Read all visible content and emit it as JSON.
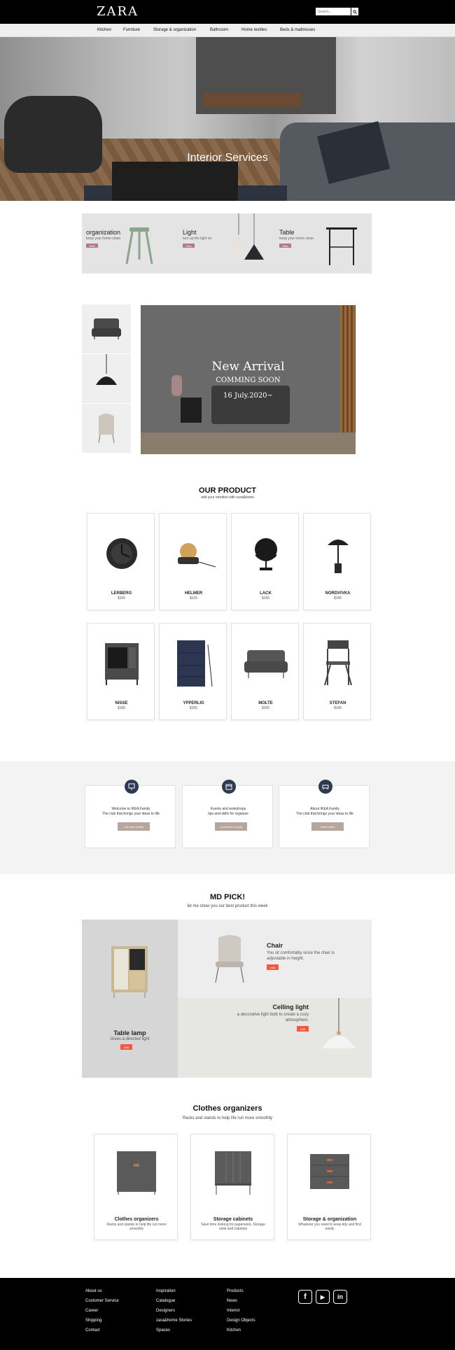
{
  "header": {
    "logo": "ZARA",
    "search_placeholder": "Search..."
  },
  "nav": [
    "Kitchen",
    "Furniture",
    "Storage & organization",
    "Bathroom",
    "Home textiles",
    "Beds & mattresses"
  ],
  "hero": {
    "title": "Interior Services"
  },
  "categories": [
    {
      "title": "organization",
      "desc": "keep your home clean",
      "btn": "View"
    },
    {
      "title": "Light",
      "desc": "turn up the light on",
      "btn": "View"
    },
    {
      "title": "Table",
      "desc": "keep your home clean",
      "btn": "View"
    }
  ],
  "arrival": {
    "title": "New Arrival",
    "subtitle": "COMMING SOON",
    "date": "16 July.2020~"
  },
  "products": {
    "title": "OUR PRODUCT",
    "subtitle": "add your emotion with zara&home",
    "items": [
      {
        "name": "LERBERG",
        "price": "$105"
      },
      {
        "name": "HELMER",
        "price": "$125"
      },
      {
        "name": "LACK",
        "price": "$155"
      },
      {
        "name": "NORDVIVKA",
        "price": "$195"
      },
      {
        "name": "NISSE",
        "price": "$165"
      },
      {
        "name": "YPPERLIG",
        "price": "$155"
      },
      {
        "name": "MOLTE",
        "price": "$250"
      },
      {
        "name": "STEFAN",
        "price": "$195"
      }
    ]
  },
  "family": [
    {
      "line1": "Welcome to IKEA Family",
      "line2": "The club that brings your ideas to life",
      "btn": "Join ikea family"
    },
    {
      "line1": "Events and workshops",
      "line2": "tips and skills for organize",
      "btn": "Local store events"
    },
    {
      "line1": "About IKEA Family",
      "line2": "The club that brings your ideas to life",
      "btn": "Great offers"
    }
  ],
  "mdpick": {
    "title": "MD PICK!",
    "subtitle": "let me show you our best product this week",
    "table_lamp": {
      "title": "Table lamp",
      "desc": "Gives a directed light",
      "btn": "Link"
    },
    "chair": {
      "title": "Chair",
      "desc": "You sit comfortably since the chair is adjustable in height.",
      "btn": "Link"
    },
    "ceiling": {
      "title": "Celling light",
      "desc": "a decorative light bulb to create a cozy atmosphere.",
      "btn": "Link"
    }
  },
  "clothes": {
    "title": "Clothes organizers",
    "subtitle": "Racks and stands to help life run more smoothly",
    "items": [
      {
        "title": "Clothes organizers",
        "desc": "Racks and stands to help life run more smoothly"
      },
      {
        "title": "Storage cabinets",
        "desc": "Save time looking for paperwork. Storage units and cabinets"
      },
      {
        "title": "Storage & organization",
        "desc": "Whatever you need to keep tidy and find easily"
      }
    ]
  },
  "footer": {
    "col1": [
      "About us",
      "Customer Service",
      "Career",
      "Shipping",
      "Contact"
    ],
    "col2": [
      "Inspiration",
      "Catalogue",
      "Designers",
      "zara&home Stories",
      "Spaces"
    ],
    "col3": [
      "Products",
      "News",
      "Interior",
      "Design Objects",
      "Kitchen"
    ],
    "social": [
      "f",
      "▶",
      "in"
    ]
  }
}
